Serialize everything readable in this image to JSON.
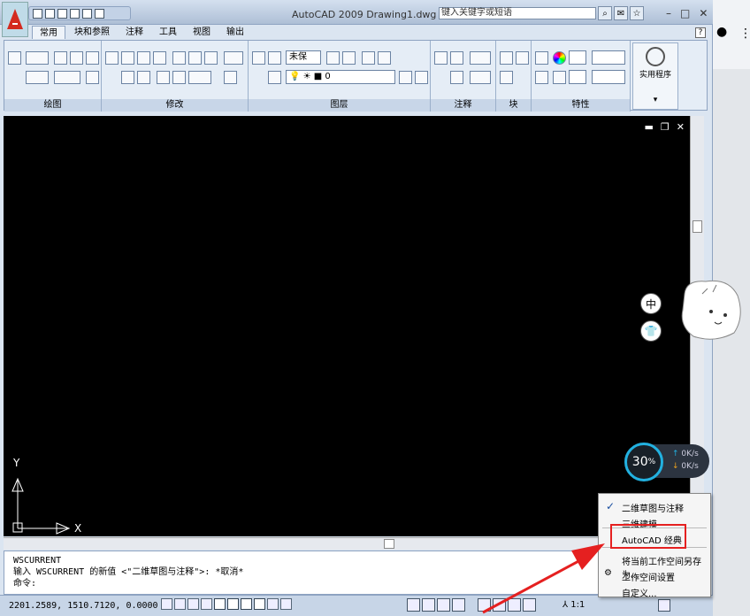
{
  "window": {
    "title": "AutoCAD 2009 Drawing1.dwg",
    "search_placeholder": "键入关键字或短语"
  },
  "tabs": [
    "常用",
    "块和参照",
    "注释",
    "工具",
    "视图",
    "输出"
  ],
  "ribbon": {
    "panels": [
      "绘图",
      "修改",
      "图层",
      "注释",
      "块",
      "特性"
    ],
    "layer_state_value": "未保",
    "layer_value": "0",
    "utility_label": "实用程序"
  },
  "command": {
    "line1": "WSCURRENT",
    "line2": "输入 WSCURRENT 的新值 <\"二维草图与注释\">: *取消*",
    "prompt": "命令:"
  },
  "status": {
    "coords": "2201.2589, 1510.7120, 0.0000",
    "scale": "1:1"
  },
  "workspace_menu": {
    "items": [
      "二维草图与注释",
      "三维建模",
      "AutoCAD 经典",
      "将当前工作空间另存为...",
      "工作空间设置",
      "自定义..."
    ],
    "checked": "二维草图与注释",
    "highlighted": "AutoCAD 经典"
  },
  "overlay": {
    "cpu_percent": "30",
    "percent_sign": "%",
    "upload": "0K/s",
    "download": "0K/s",
    "btn_chinese": "中",
    "btn_shirt": "shirt-icon"
  },
  "colors": {
    "annotation_red": "#e52020",
    "gauge_blue": "#22b1e0"
  }
}
